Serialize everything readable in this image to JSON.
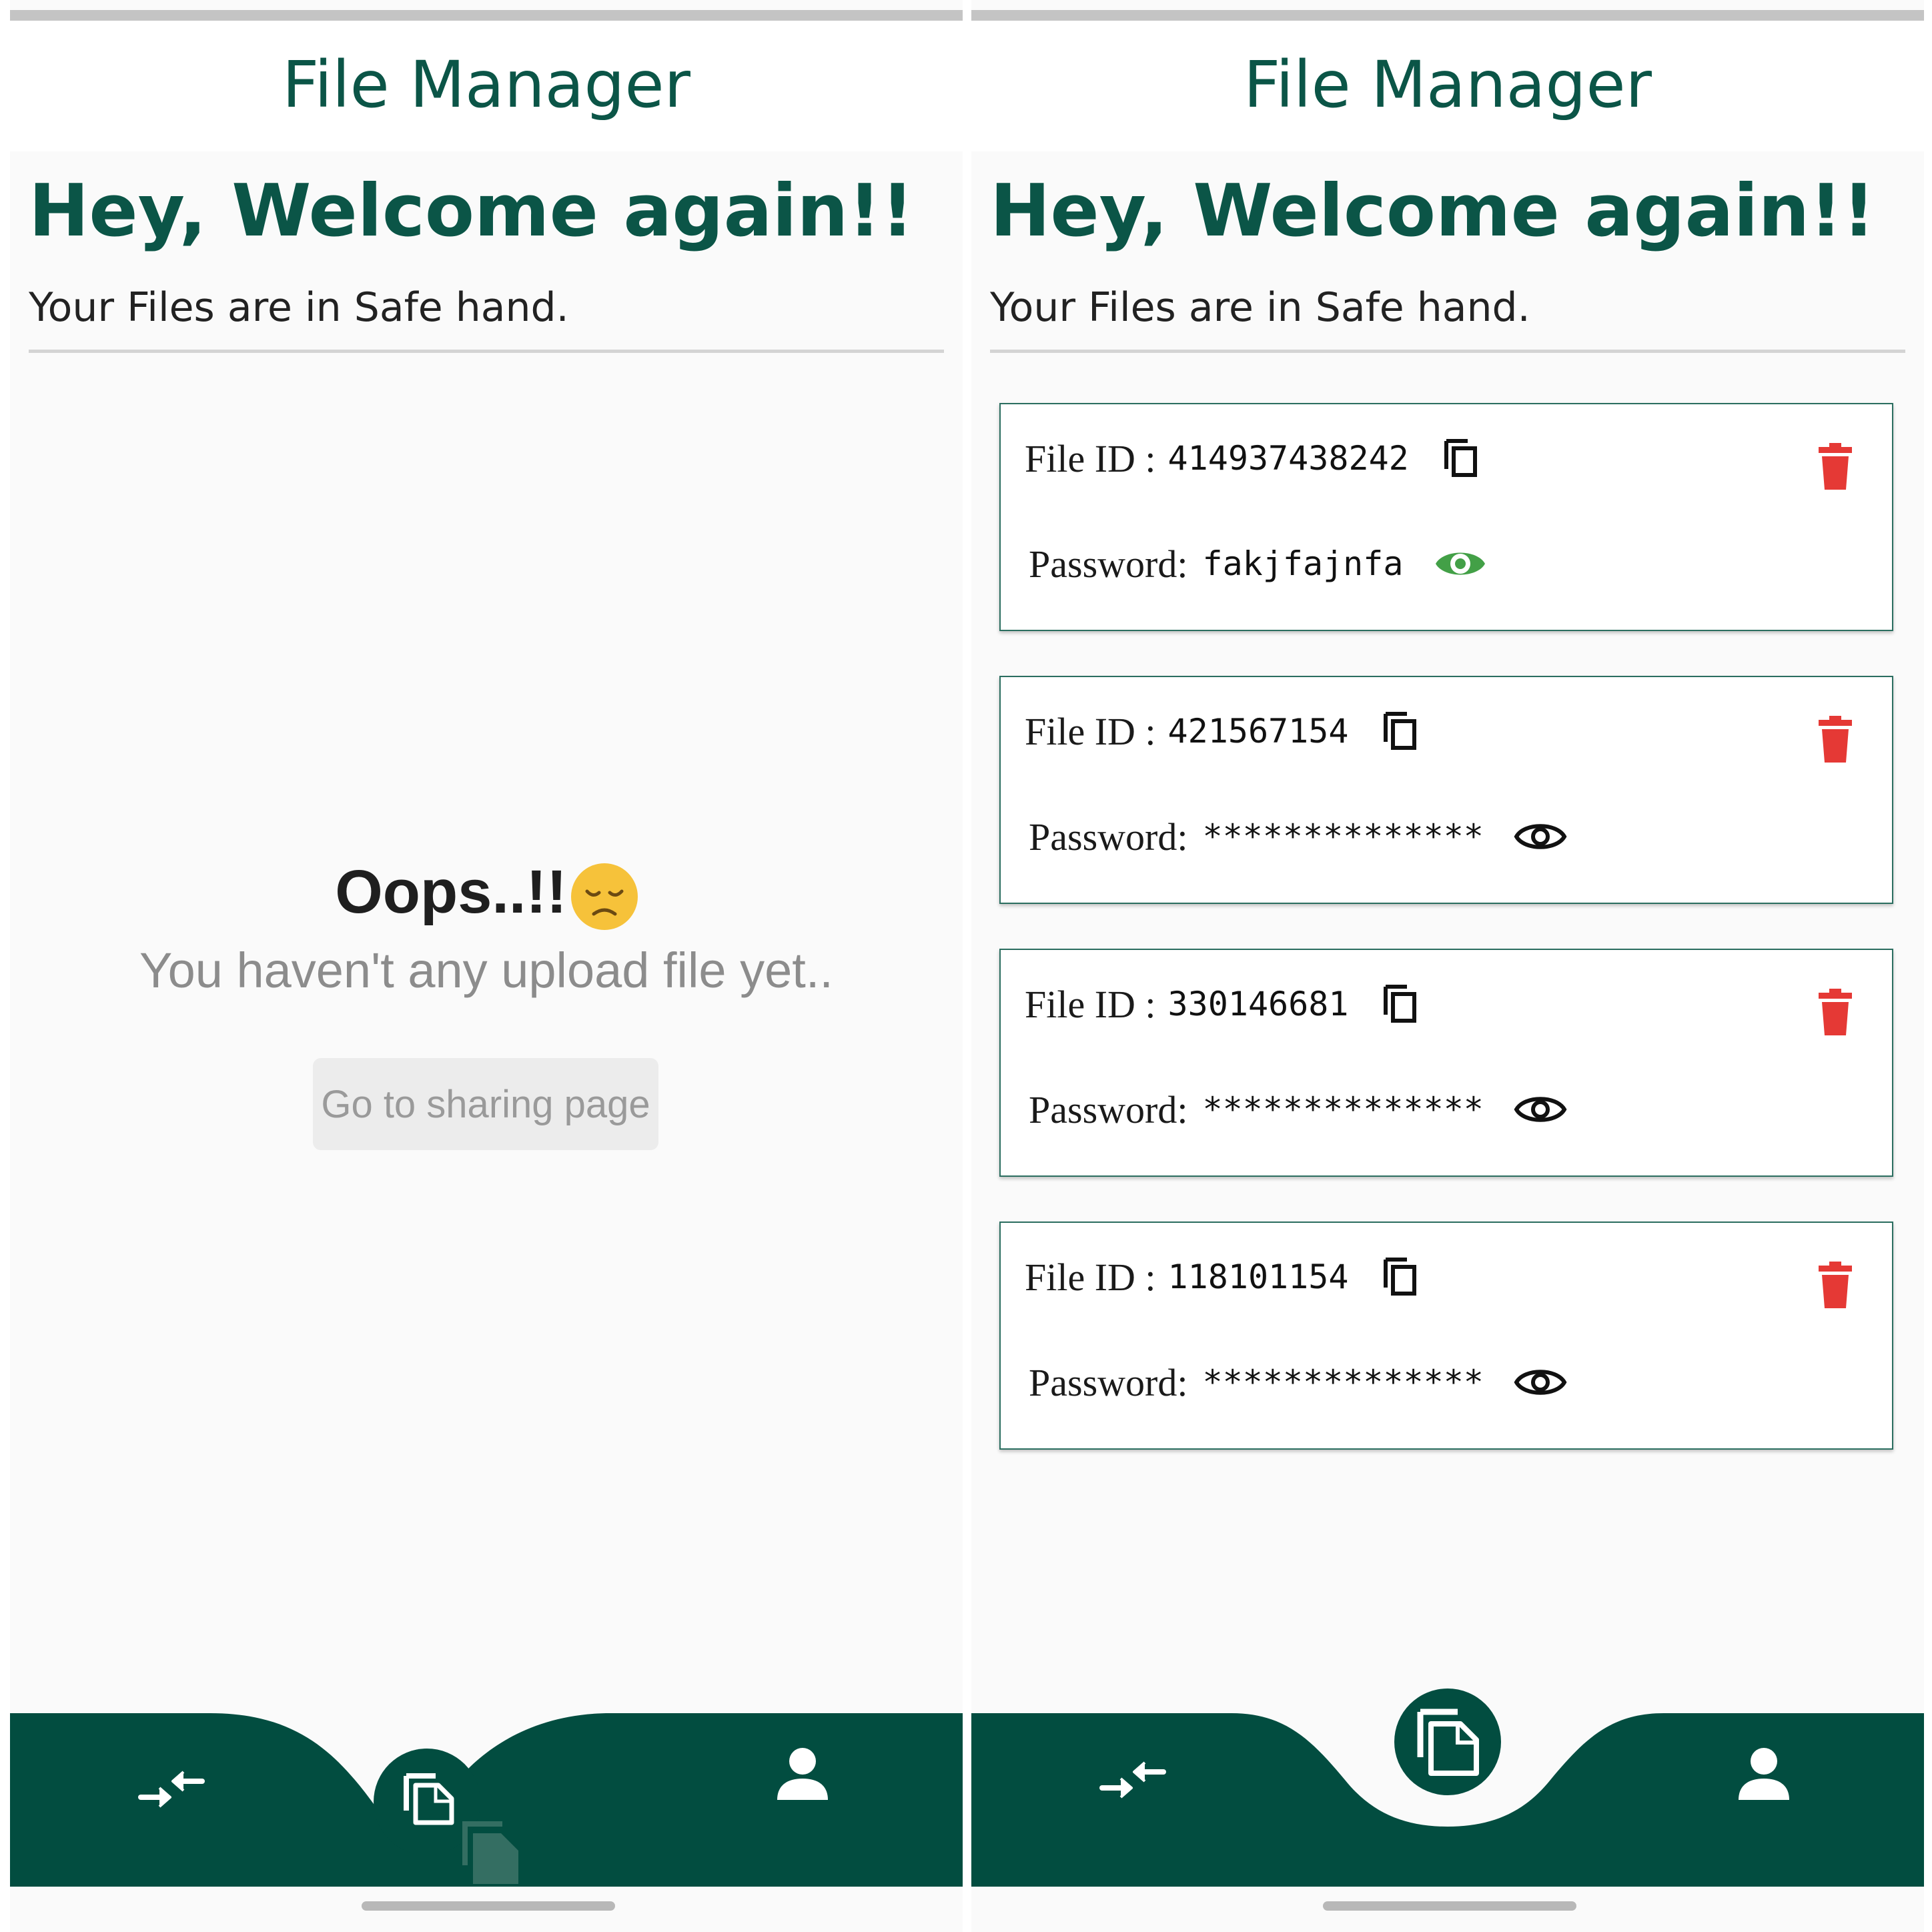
{
  "left_screen": {
    "app_title": "File Manager",
    "welcome_heading": "Hey, Welcome again!!",
    "subtitle": "Your Files are in Safe hand.",
    "empty_state": {
      "title": "Oops..!!",
      "emoji_icon": "disappointed-face-emoji",
      "message": "You haven't any upload file yet..",
      "button_label": "Go to sharing page"
    },
    "nav": {
      "left_icon": "transfer-arrows-icon",
      "center_icon": "files-icon",
      "right_icon": "person-icon",
      "active": "files"
    }
  },
  "right_screen": {
    "app_title": "File Manager",
    "welcome_heading": "Hey, Welcome again!!",
    "subtitle": "Your Files are in Safe hand.",
    "file_id_label": "File ID :",
    "password_label": "Password:",
    "files": [
      {
        "file_id": "414937438242",
        "password": "fakjfajnfa",
        "password_visible": true
      },
      {
        "file_id": "421567154",
        "password": "**************",
        "password_visible": false
      },
      {
        "file_id": "330146681",
        "password": "**************",
        "password_visible": false
      },
      {
        "file_id": "118101154",
        "password": "**************",
        "password_visible": false
      }
    ],
    "nav": {
      "left_icon": "transfer-arrows-icon",
      "center_icon": "files-icon",
      "right_icon": "person-icon",
      "active": "files"
    }
  },
  "colors": {
    "primary": "#0b5547",
    "nav_background": "#024d40",
    "delete": "#e53935",
    "eye_visible": "#43a047"
  }
}
